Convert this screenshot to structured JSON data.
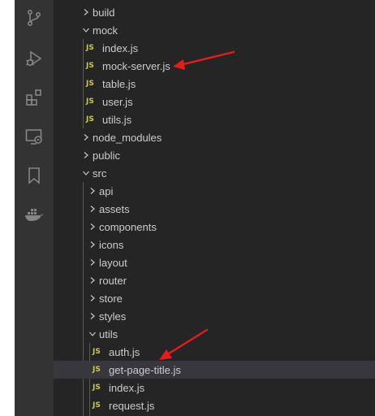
{
  "activity_bar": {
    "icons": [
      "source-control-icon",
      "run-debug-icon",
      "extensions-icon",
      "remote-explorer-icon",
      "bookmarks-icon",
      "docker-icon"
    ]
  },
  "tree": {
    "build": "build",
    "mock": "mock",
    "mock_index": "index.js",
    "mock_server": "mock-server.js",
    "mock_table": "table.js",
    "mock_user": "user.js",
    "mock_utils": "utils.js",
    "node_modules": "node_modules",
    "public": "public",
    "src": "src",
    "api": "api",
    "assets": "assets",
    "components": "components",
    "icons": "icons",
    "layout": "layout",
    "router": "router",
    "store": "store",
    "styles": "styles",
    "utils": "utils",
    "utils_auth": "auth.js",
    "utils_get_page_title": "get-page-title.js",
    "utils_index": "index.js",
    "utils_request": "request.js",
    "js_badge": "JS"
  },
  "colors": {
    "activity_bar_bg": "#333333",
    "sidebar_bg": "#252526",
    "text": "#cccccc",
    "js_badge": "#cbcb41",
    "selected_row": "#37373d",
    "annotation_arrow": "#e51c1c"
  }
}
